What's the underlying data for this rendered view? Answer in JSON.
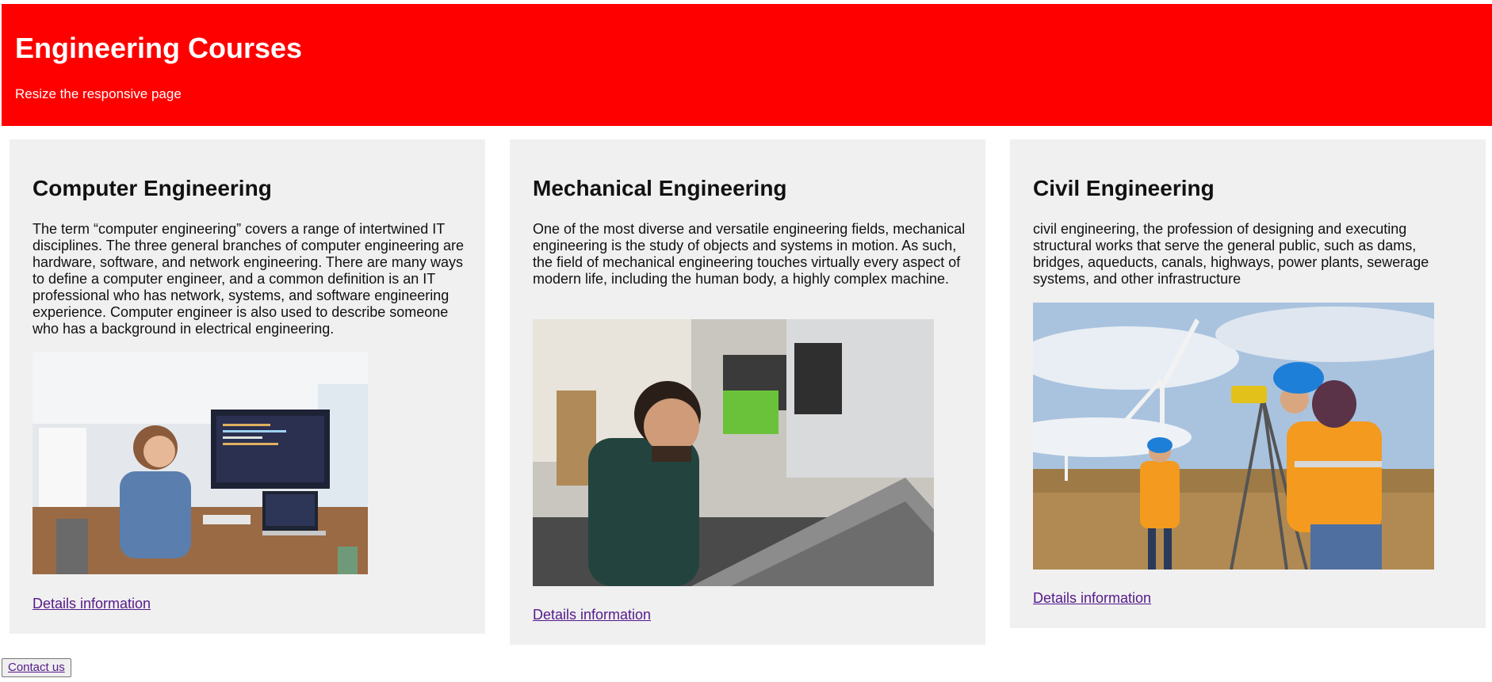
{
  "header": {
    "title": "Engineering Courses",
    "subtitle": "Resize the responsive page"
  },
  "courses": [
    {
      "title": "Computer Engineering",
      "description": "The term “computer engineering” covers a range of intertwined IT disciplines. The three general branches of computer engineering are hardware, software, and network engineering. There are many ways to define a computer engineer, and a common definition is an IT professional who has network, systems, and software engineering experience. Computer engineer is also used to describe someone who has a background in electrical engineering.",
      "image_subject": "woman-at-computer-desk-photo",
      "link_label": "Details information"
    },
    {
      "title": "Mechanical Engineering",
      "description": "One of the most diverse and versatile engineering fields, mechanical engineering is the study of objects and systems in motion. As such, the field of mechanical engineering touches virtually every aspect of modern life, including the human body, a highly complex machine.",
      "image_subject": "engineer-working-on-machine-photo",
      "link_label": "Details information"
    },
    {
      "title": "Civil Engineering",
      "description": "civil engineering, the profession of designing and executing structural works that serve the general public, such as dams, bridges, aqueducts, canals, highways, power plants, sewerage systems, and other infrastructure",
      "image_subject": "surveyors-with-wind-turbines-photo",
      "link_label": "Details information"
    }
  ],
  "footer": {
    "contact_label": "Contact us"
  },
  "colors": {
    "header_bg": "#ff0000",
    "card_bg": "#f0f0f0",
    "link": "#551a8b"
  }
}
